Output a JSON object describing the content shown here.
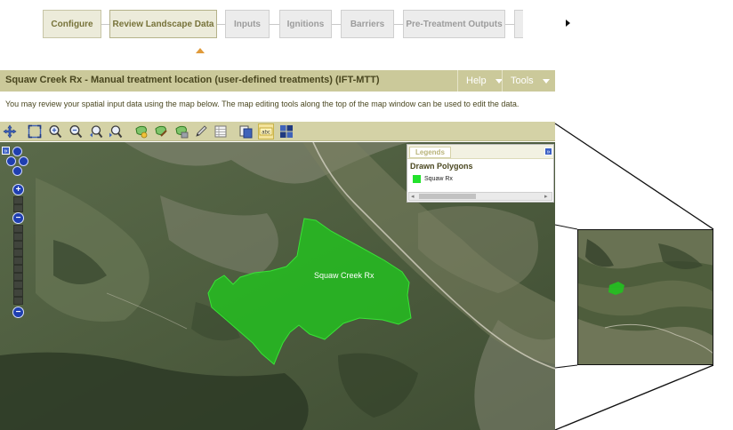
{
  "workflow": {
    "steps": [
      {
        "label": "Configure",
        "state": "done"
      },
      {
        "label": "Review Landscape Data",
        "state": "current"
      },
      {
        "label": "Inputs",
        "state": "pending"
      },
      {
        "label": "Ignitions",
        "state": "pending"
      },
      {
        "label": "Barriers",
        "state": "pending"
      },
      {
        "label": "Pre-Treatment Outputs",
        "state": "pending"
      },
      {
        "label": "",
        "state": "pending"
      }
    ],
    "next_icon": "right-arrow-icon"
  },
  "header": {
    "title": "Squaw Creek Rx - Manual treatment location (user-defined treatments) (IFT-MTT)",
    "help_label": "Help",
    "tools_label": "Tools"
  },
  "description": "You may review your spatial input data using the map below. The map editing tools along the top of the map window can be used to edit the data.",
  "toolbar": {
    "tools": [
      "pan-icon",
      "zoom-extent-icon",
      "zoom-in-icon",
      "zoom-out-icon",
      "zoom-previous-icon",
      "zoom-next-icon",
      "draw-polygon-icon",
      "edit-polygon-icon",
      "delete-polygon-icon",
      "edit-pencil-icon",
      "attribute-table-icon",
      "layers-icon",
      "label-icon",
      "map-grid-icon"
    ],
    "active_tool": "label-icon"
  },
  "map": {
    "expander_label": "»",
    "zoom_in_label": "+",
    "zoom_out_label": "−",
    "polygon_label": "Squaw Creek Rx",
    "polygon_color": "#22c21f",
    "legend": {
      "tab_label": "Legends",
      "collapse_label": "»",
      "heading": "Drawn Polygons",
      "items": [
        {
          "label": "Squaw Rx",
          "color": "#22e22c"
        }
      ],
      "scroll_left": "◂",
      "scroll_right": "▸"
    }
  },
  "colors": {
    "accent": "#cbc99a",
    "title_text": "#4a4720",
    "current_step_caret": "#e09a3a"
  }
}
